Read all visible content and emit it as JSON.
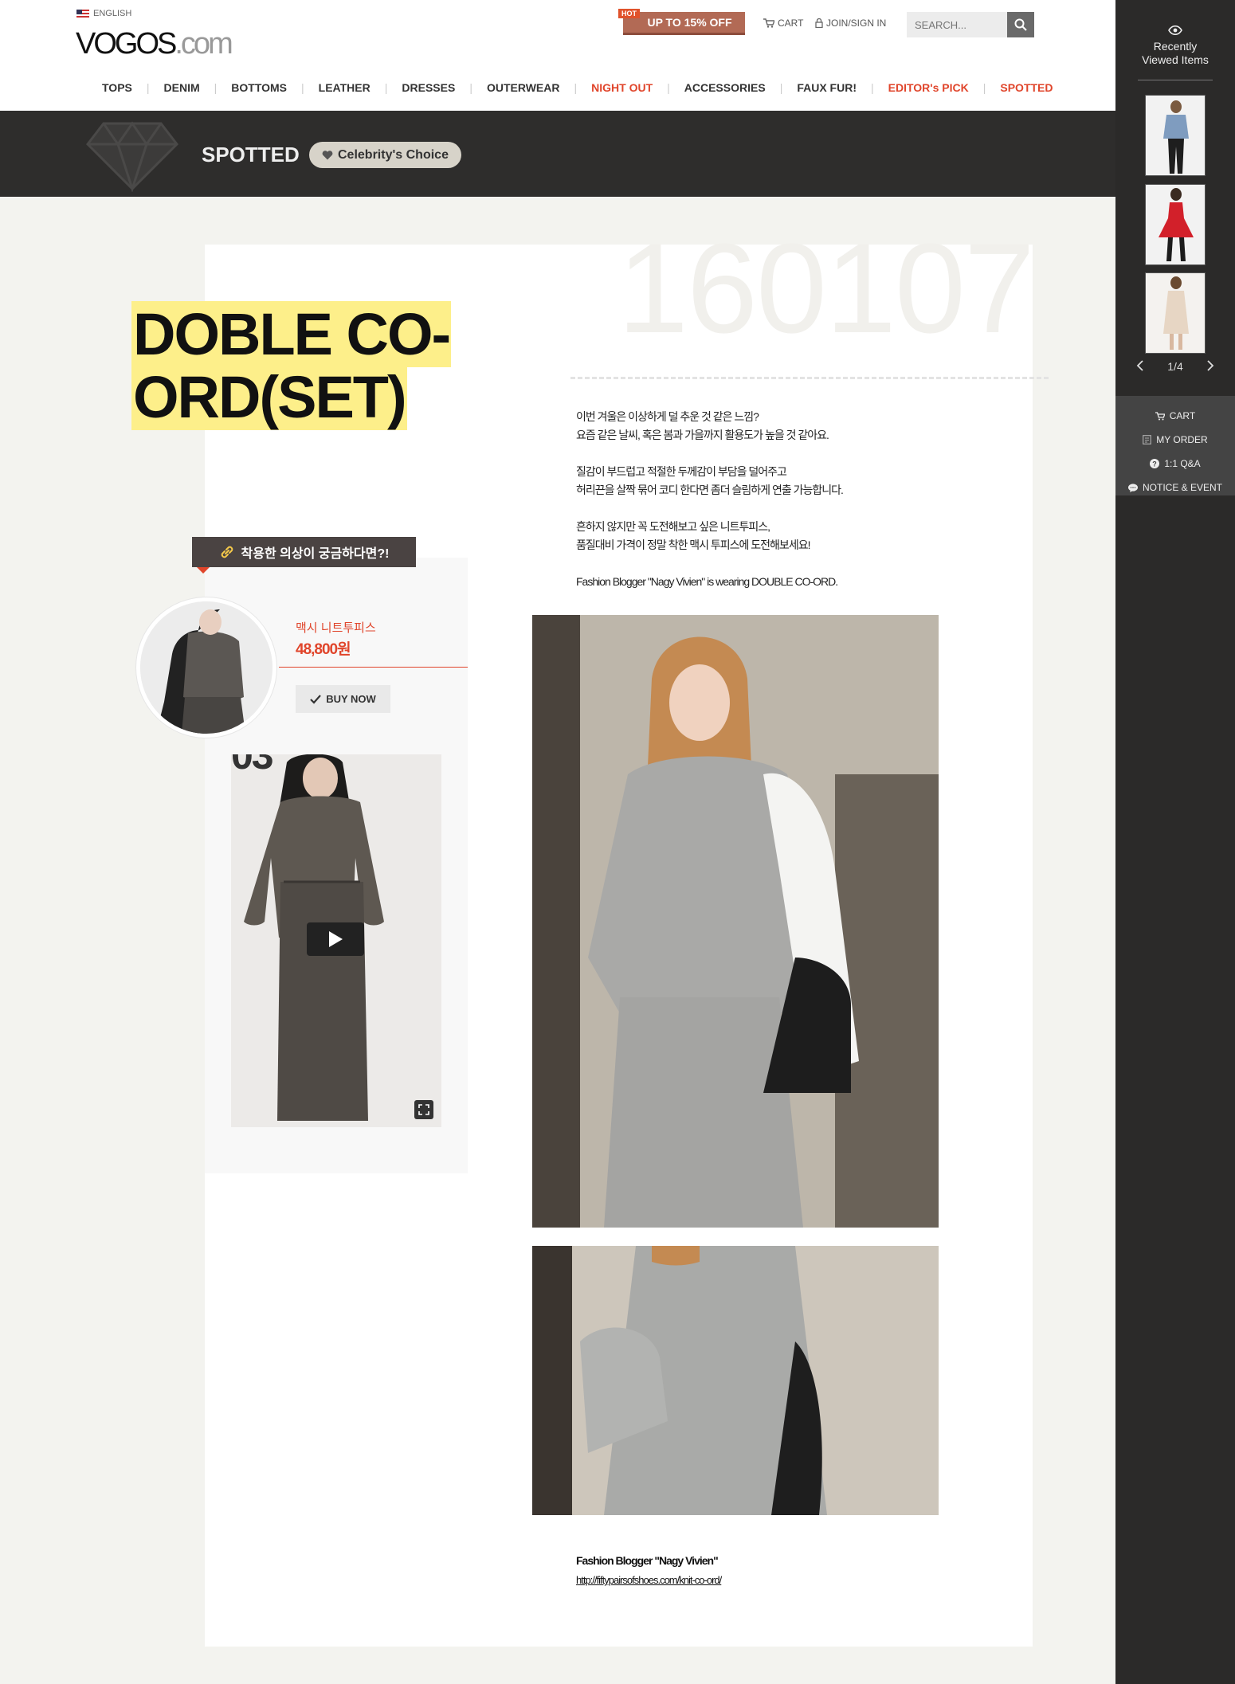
{
  "header": {
    "language": "ENGLISH",
    "logo_brand": "VOGOS",
    "logo_domain": ".com",
    "promo_badge": "HOT",
    "promo_text": "UP TO 15% OFF",
    "cart_label": "CART",
    "join_label": "JOIN/SIGN IN",
    "search_placeholder": "SEARCH..."
  },
  "nav": {
    "items": [
      {
        "label": "TOPS"
      },
      {
        "label": "DENIM"
      },
      {
        "label": "BOTTOMS"
      },
      {
        "label": "LEATHER"
      },
      {
        "label": "DRESSES"
      },
      {
        "label": "OUTERWEAR"
      },
      {
        "label": "NIGHT OUT",
        "highlight": true
      },
      {
        "label": "ACCESSORIES"
      },
      {
        "label": "FAUX FUR!"
      },
      {
        "label": "EDITOR's PICK",
        "highlight": true
      },
      {
        "label": "SPOTTED",
        "highlight": true
      }
    ]
  },
  "spotted_bar": {
    "title": "SPOTTED",
    "badge": "Celebrity's Choice"
  },
  "sidebar": {
    "recent_title_1": "Recently",
    "recent_title_2": "Viewed Items",
    "page_indicator": "1/4",
    "menu": [
      {
        "label": "CART",
        "icon": "cart-icon"
      },
      {
        "label": "MY ORDER",
        "icon": "order-icon"
      },
      {
        "label": "1:1 Q&A",
        "icon": "question-icon"
      },
      {
        "label": "NOTICE & EVENT",
        "icon": "chat-icon"
      }
    ]
  },
  "post": {
    "date_number": "160107",
    "title_line1": "DOBLE CO-",
    "title_line2": "ORD(SET)",
    "desc": [
      [
        "이번 겨울은 이상하게 덜 추운 것 같은 느낌?",
        "요즘 같은 날씨, 혹은 봄과 가을까지 활용도가 높을 것 같아요."
      ],
      [
        "질감이 부드럽고 적절한 두께감이 부담을 덜어주고",
        "허리끈을 살짝 묶어 코디 한다면 좀더 슬림하게 연출 가능합니다."
      ],
      [
        "흔하지 않지만 꼭 도전해보고 싶은 니트투피스,",
        "품질대비 가격이 정말 착한 맥시 투피스에 도전해보세요!"
      ],
      [
        "Fashion Blogger \"Nagy Vivien\" is wearing DOUBLE CO-ORD."
      ]
    ],
    "credit_name": "Fashion Blogger \"Nagy Vivien\"",
    "credit_url": "http://fiftypairsofshoes.com/knit-co-ord/"
  },
  "product_card": {
    "ribbon_text": "착용한 의상이 궁금하다면?!",
    "product_name": "맥시 니트투피스",
    "product_price": "48,800원",
    "buy_label": "BUY NOW",
    "video_number": "03"
  },
  "colors": {
    "accent_red": "#e0452b",
    "highlight_yellow": "#fdef8a",
    "dark_bar": "#2e2d2c",
    "sidebar": "#2b2a29"
  }
}
